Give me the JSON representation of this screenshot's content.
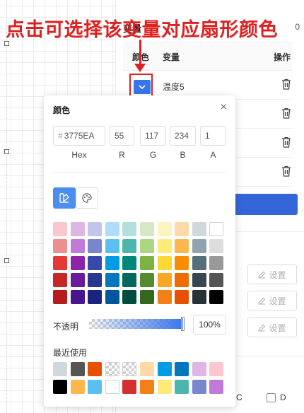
{
  "annotation": {
    "text": "点击可选择该变量对应扇形颜色"
  },
  "panel": {
    "section_title": "变量",
    "section_right": "0",
    "headers": {
      "color": "颜色",
      "variable": "变量",
      "action": "操作"
    },
    "rows": [
      {
        "name": "温度5",
        "color": "#3775EA"
      },
      {
        "name": ""
      },
      {
        "name": ""
      },
      {
        "name": ""
      }
    ],
    "setting_buttons": [
      "设置",
      "设置",
      "设置"
    ],
    "checkboxes": [
      {
        "label": "C"
      },
      {
        "label": "D"
      }
    ]
  },
  "picker": {
    "title": "颜色",
    "close": "×",
    "hex": {
      "prefix": "#",
      "value": "3775EA",
      "label": "Hex"
    },
    "r": {
      "value": "55",
      "label": "R"
    },
    "g": {
      "value": "117",
      "label": "G"
    },
    "b": {
      "value": "234",
      "label": "B"
    },
    "a": {
      "value": "1",
      "label": "A"
    },
    "modes": [
      {
        "icon": "swatch-palette-icon",
        "active": true
      },
      {
        "icon": "color-palette-icon",
        "active": false
      }
    ],
    "palette": [
      [
        "#FBC7CF",
        "#DDB6E3",
        "#C1C5EA",
        "#AFDCF8",
        "#B3DFDC",
        "#D6E8C3",
        "#FFF3C0",
        "#FFD9A8",
        "#CFD8DC",
        "#FFFFFF"
      ],
      [
        "#EE8F8F",
        "#C07ADA",
        "#7986CB",
        "#5BC0F0",
        "#4DB6AC",
        "#AED581",
        "#FFEB7A",
        "#FFB74D",
        "#90A4AE",
        "#DDDDDD"
      ],
      [
        "#E53935",
        "#8E24AA",
        "#3949AB",
        "#039BE5",
        "#00897B",
        "#7CB342",
        "#FDD835",
        "#FB8C00",
        "#546E7A",
        "#999999"
      ],
      [
        "#C62828",
        "#6A1B9A",
        "#283593",
        "#0277BD",
        "#00695C",
        "#558B2F",
        "#F9A825",
        "#EF6C00",
        "#37474F",
        "#555555"
      ],
      [
        "#B71C1C",
        "#4A148C",
        "#1A237E",
        "#01579B",
        "#004D40",
        "#33691E",
        "#F57F17",
        "#E65100",
        "#263238",
        "#000000"
      ]
    ],
    "opacity": {
      "label": "不透明",
      "value": "100%",
      "fraction": 1.0
    },
    "recent": {
      "label": "最近使用",
      "colors": [
        [
          "#CFD8DC",
          "#555555",
          "#E65100",
          "transparent",
          "transparent",
          "#FFD9A8",
          "#039BE5",
          "#0277BD",
          "#DDB6E3",
          "#FBC7CF"
        ],
        [
          "#000000",
          "#FFB74D",
          "#5BC0F0",
          "#FFFFFF",
          "#D32F2F",
          "#F57F17",
          "#FFEB7A",
          "#4DB6AC",
          "#7986CB",
          "#C07ADA"
        ]
      ]
    }
  }
}
